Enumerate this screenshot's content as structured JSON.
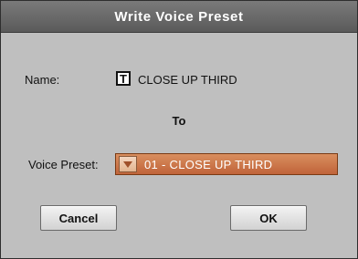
{
  "dialog": {
    "title": "Write Voice Preset",
    "name_label": "Name:",
    "name_icon_glyph": "T",
    "name_value": "CLOSE UP THIRD",
    "to_label": "To",
    "preset_label": "Voice Preset:",
    "preset_value": "01 - CLOSE UP THIRD",
    "cancel_label": "Cancel",
    "ok_label": "OK"
  },
  "icons": {
    "name_field": "text-icon",
    "dropdown": "triangle-down-icon"
  },
  "colors": {
    "title_bar": "#6a6a6a",
    "dialog_bg": "#bfbfbf",
    "preset_select": "#c97a4c"
  }
}
